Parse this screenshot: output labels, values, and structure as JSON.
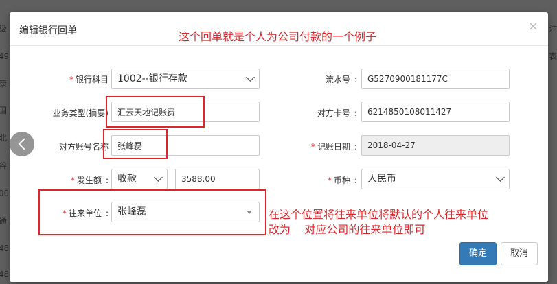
{
  "background": {
    "left_fragments": [
      "级",
      "49",
      "康",
      "国",
      "北",
      "谷",
      "00",
      "通",
      "48",
      "48"
    ],
    "right_fragments": [
      "注",
      "表",
      "",
      "",
      "",
      "",
      "",
      "",
      "",
      ""
    ]
  },
  "modal": {
    "title": "编辑银行回单",
    "close_glyph": "×"
  },
  "annotations": {
    "top_note": "这个回单就是个人为公司付款的一个例子",
    "bottom_note_line1": "在这个位置将往来单位将默认的个人往来单位",
    "bottom_note_line2": "改为    对应公司的往来单位即可"
  },
  "form": {
    "bank_subject": {
      "label": "银行科目",
      "value": "1002--银行存款"
    },
    "serial_no": {
      "label": "流水号",
      "value": "G5270900181177C"
    },
    "business_type": {
      "label": "业务类型(摘要)",
      "value": "汇云天地记账费"
    },
    "counter_card": {
      "label": "对方卡号",
      "value": "6214850108011427"
    },
    "counter_account_name": {
      "label": "对方账号名称",
      "value": "张峰磊"
    },
    "post_date": {
      "label": "记账日期",
      "value": "2018-04-27"
    },
    "amount": {
      "label": "发生额",
      "direction": "收款",
      "value": "3588.00"
    },
    "currency": {
      "label": "币种",
      "value": "人民币"
    },
    "partner": {
      "label": "往来单位",
      "value": "张峰磊"
    }
  },
  "buttons": {
    "confirm": "确定",
    "cancel": "取消"
  },
  "colors": {
    "annotation_red": "#e0252a",
    "primary_blue": "#337ab7"
  }
}
